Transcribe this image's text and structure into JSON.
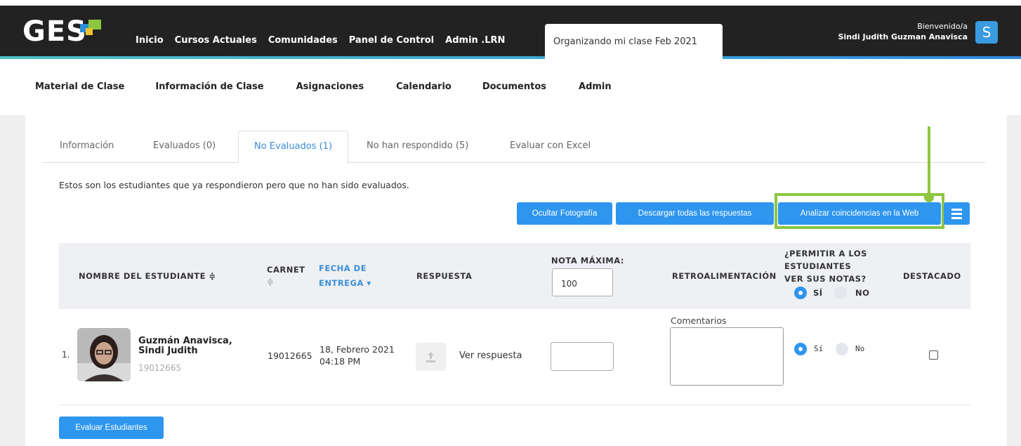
{
  "header": {
    "logo_text": "GES",
    "nav": [
      "Inicio",
      "Cursos Actuales",
      "Comunidades",
      "Panel de Control",
      "Admin .LRN"
    ],
    "active_course": "Organizando mi clase Feb 2021",
    "welcome": "Bienvenido/a",
    "user_name": "Sindi Judith Guzman Anavisca",
    "avatar_letter": "S"
  },
  "subnav": [
    "Material de Clase",
    "Información de Clase",
    "Asignaciones",
    "Calendario",
    "Documentos",
    "Admin"
  ],
  "tabs": [
    {
      "label": "Información"
    },
    {
      "label": "Evaluados (0)"
    },
    {
      "label": "No Evaluados (1)",
      "active": true
    },
    {
      "label": "No han respondido (5)"
    },
    {
      "label": "Evaluar con Excel"
    }
  ],
  "description": "Estos son los estudiantes que ya respondieron pero que no han sido evaluados.",
  "actions": {
    "hide_photo": "Ocultar Fotografía",
    "download_all": "Descargar todas las respuestas",
    "analyze": "Analizar coincidencias en la Web"
  },
  "table": {
    "headers": {
      "student": "NOMBRE DEL ESTUDIANTE ≑",
      "carnet": "CARNET",
      "carnet_sort": "≑",
      "date_1": "FECHA DE",
      "date_2": "ENTREGA ▾",
      "response": "RESPUESTA",
      "max_grade": "NOTA MÁXIMA:",
      "max_grade_value": "100",
      "feedback": "RETROALIMENTACIÓN",
      "allow_1": "¿PERMITIR A LOS",
      "allow_2": "ESTUDIANTES",
      "allow_3": "VER SUS NOTAS?",
      "yes": "SÍ",
      "no": "NO",
      "featured": "DESTACADO"
    },
    "rows": [
      {
        "num": "1.",
        "name_1": "Guzmán Anavisca,",
        "name_2": "Sindi Judith",
        "carnet_sub": "19012665",
        "carnet": "19012665",
        "date_1": "18, Febrero 2021",
        "date_2": "04:18 PM",
        "response_link": "Ver respuesta",
        "comments_label": "Comentarios",
        "yes": "Sí",
        "no": "No"
      }
    ]
  },
  "footer": {
    "evaluate": "Evaluar Estudiantes"
  },
  "colors": {
    "accent": "#2e96ef",
    "highlight": "#8cc63f",
    "topbar": "#222222"
  }
}
